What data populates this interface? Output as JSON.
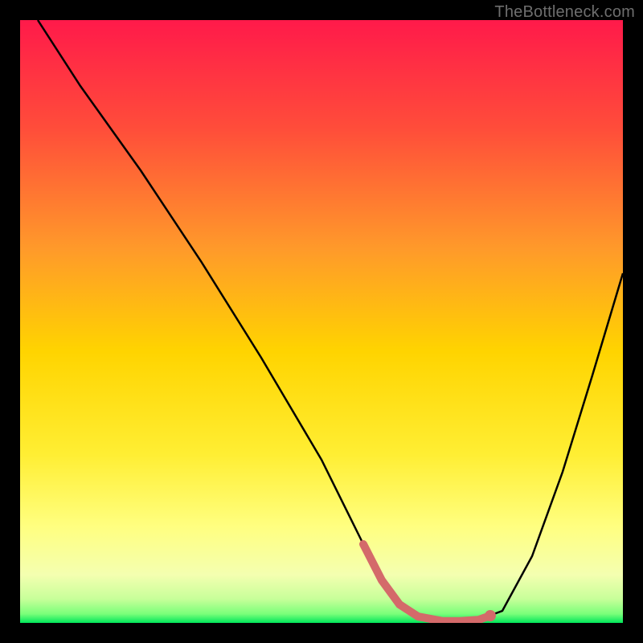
{
  "watermark": "TheBottleneck.com",
  "colors": {
    "top": "#ff1a4a",
    "mid_upper": "#ff7a2a",
    "mid": "#ffd400",
    "mid_lower": "#ffff66",
    "near_bottom": "#f6ffb0",
    "bottom": "#00e65a",
    "curve": "#000000",
    "marker": "#d46a6a",
    "frame": "#000000"
  },
  "chart_data": {
    "type": "line",
    "title": "",
    "xlabel": "",
    "ylabel": "",
    "xlim": [
      0,
      100
    ],
    "ylim": [
      0,
      100
    ],
    "x": [
      3,
      10,
      20,
      30,
      40,
      50,
      57,
      60,
      63,
      66,
      70,
      73,
      76,
      80,
      85,
      90,
      95,
      100
    ],
    "values": [
      100,
      89,
      75,
      60,
      44,
      27,
      13,
      7,
      3,
      1,
      0.3,
      0.3,
      0.5,
      2,
      11,
      25,
      41,
      58
    ],
    "series": [
      {
        "name": "bottleneck-curve",
        "x": [
          3,
          10,
          20,
          30,
          40,
          50,
          57,
          60,
          63,
          66,
          70,
          73,
          76,
          80,
          85,
          90,
          95,
          100
        ],
        "values": [
          100,
          89,
          75,
          60,
          44,
          27,
          13,
          7,
          3,
          1,
          0.3,
          0.3,
          0.5,
          2,
          11,
          25,
          41,
          58
        ]
      }
    ],
    "annotations": {
      "optimal_range_x": [
        57,
        78
      ],
      "optimal_marker_dot_x": 78
    }
  }
}
